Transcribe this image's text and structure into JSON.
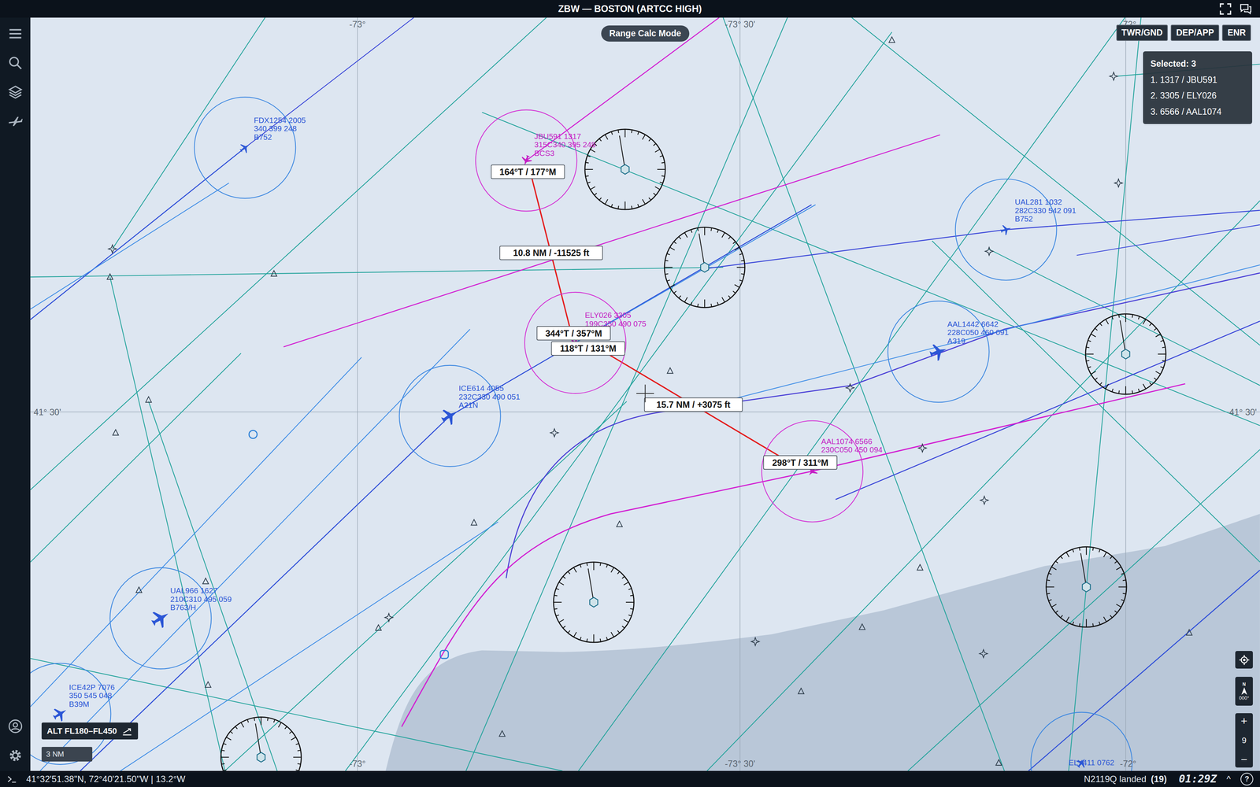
{
  "window": {
    "title": "ZBW — BOSTON (ARTCC HIGH)"
  },
  "mode_pill": "Range Calc Mode",
  "view_buttons": [
    {
      "label": "TWR/GND",
      "selected": false
    },
    {
      "label": "DEP/APP",
      "selected": false
    },
    {
      "label": "ENR",
      "selected": false
    }
  ],
  "selection_panel": {
    "title": "Selected: 3",
    "items": [
      "1. 1317 / JBU591",
      "2. 3305 / ELY026",
      "3. 6566 / AAL1074"
    ]
  },
  "grid_labels": [
    "-73°",
    "-73° 30'",
    "-72°",
    "-73°",
    "-73° 30'",
    "-72°",
    "41° 30'",
    "41° 30'"
  ],
  "aircraft": [
    {
      "lines": [
        "FDX1254 2005",
        "340 399 248",
        "B752"
      ],
      "selected": false
    },
    {
      "lines": [
        "JBU591 1317",
        "315C340 395 248",
        "BCS3"
      ],
      "selected": true
    },
    {
      "lines": [
        "ELY026 3305",
        "199C350 490 075"
      ],
      "selected": true
    },
    {
      "lines": [
        "AAL1074 6566",
        "230C050 450 094"
      ],
      "selected": true
    },
    {
      "lines": [
        "UAL281 1032",
        "282C330 542 091",
        "B752"
      ],
      "selected": false
    },
    {
      "lines": [
        "AAL1442 6642",
        "228C050 460 091",
        "A319"
      ],
      "selected": false
    },
    {
      "lines": [
        "ICE614 4055",
        "232C330 490 051",
        "A21N"
      ],
      "selected": false
    },
    {
      "lines": [
        "UAL966 1627",
        "210C310 495 059",
        "B763/H"
      ],
      "selected": false
    },
    {
      "lines": [
        "ICE42P 7076",
        "350 545 048",
        "B39M"
      ],
      "selected": false
    },
    {
      "lines": [
        "ELY411 0762"
      ],
      "selected": false
    }
  ],
  "range_measurements": [
    {
      "from_bearing": "164°T / 177°M",
      "distance": "10.8 NM / -11525 ft",
      "to_bearing": "344°T / 357°M"
    },
    {
      "from_bearing": "118°T / 131°M",
      "distance": "15.7 NM / +3075 ft",
      "to_bearing": "298°T / 311°M"
    }
  ],
  "map_controls": {
    "north": "N",
    "heading": "000°",
    "zoom_in": "+",
    "zoom_level": "9",
    "zoom_out": "−"
  },
  "filters": {
    "altitude": "ALT FL180–FL450",
    "range": "3 NM"
  },
  "status_bar": {
    "coordinates": "41°32'51.38\"N, 72°40'21.50\"W | 13.2°W",
    "event": "N2119Q landed",
    "event_count": "(19)",
    "time": "01:29Z",
    "expand": "^",
    "help": "?"
  }
}
